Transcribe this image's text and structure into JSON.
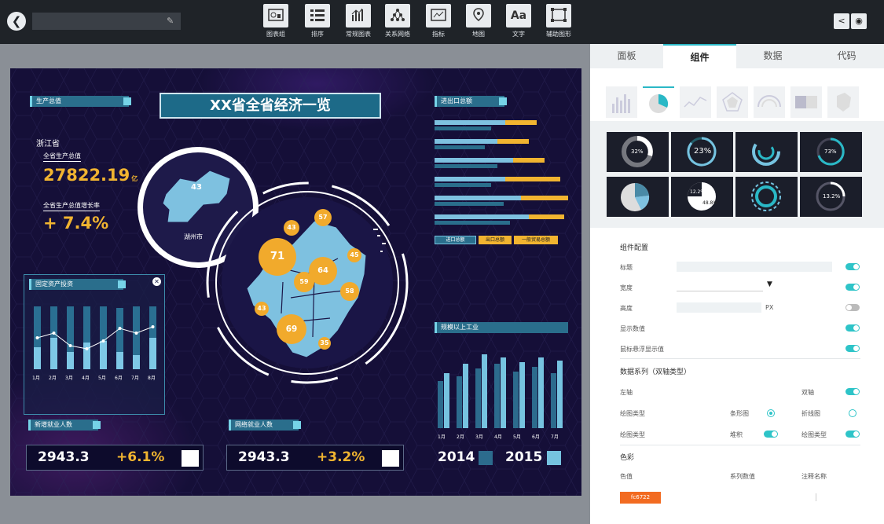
{
  "toolbar": {
    "title_value": "",
    "tools": [
      {
        "label": "图表组"
      },
      {
        "label": "排序"
      },
      {
        "label": "常规图表"
      },
      {
        "label": "关系网络"
      },
      {
        "label": "指标"
      },
      {
        "label": "地图"
      },
      {
        "label": "文字",
        "glyph": "Aa"
      },
      {
        "label": "辅助图形"
      }
    ]
  },
  "dashboard": {
    "title": "XX省全省经济一览",
    "gdp": {
      "section": "生产总值",
      "province": "浙江省",
      "total_label": "全省生产总值",
      "total_value": "27822.19",
      "total_unit": "亿",
      "growth_label": "全省生产总值增长率",
      "growth_value": "+ 7.4%"
    },
    "fixed_asset": {
      "title": "固定资产投资",
      "months": [
        "1月",
        "2月",
        "3月",
        "4月",
        "5月",
        "6月",
        "7月",
        "8月"
      ]
    },
    "city": {
      "value": "43",
      "name": "湖州市"
    },
    "import_export": {
      "title": "进出口总额",
      "legend": [
        "进口总额",
        "出口总额",
        "一般贸易总额"
      ]
    },
    "industry": {
      "title": "规模以上工业",
      "months": [
        "1月",
        "2月",
        "3月",
        "4月",
        "5月",
        "6月",
        "7月"
      ],
      "years": [
        "2014",
        "2015"
      ]
    },
    "employment": {
      "title": "新增就业人数",
      "value": "2943.3",
      "change": "+6.1%"
    },
    "network_employment": {
      "title": "网络就业人数",
      "value": "2943.3",
      "change": "+3.2%"
    },
    "map_bubbles": [
      {
        "value": "43"
      },
      {
        "value": "57"
      },
      {
        "value": "71"
      },
      {
        "value": "64"
      },
      {
        "value": "45"
      },
      {
        "value": "59"
      },
      {
        "value": "58"
      },
      {
        "value": "43"
      },
      {
        "value": "69"
      },
      {
        "value": "35"
      }
    ]
  },
  "panel": {
    "tabs": [
      "面板",
      "组件",
      "数据",
      "代码"
    ],
    "active_tab": "组件",
    "thumbs_text": [
      "32%",
      "23%",
      "73%",
      "12.2%",
      "48.8%",
      "13.2%"
    ],
    "config": {
      "heading": "组件配置",
      "title_label": "标题",
      "width_label": "宽度",
      "height_label": "高度",
      "height_unit": "PX",
      "show_values": "显示数值",
      "hover_values": "鼠标悬浮显示值",
      "series_heading": "数据系列（双轴类型）",
      "left_axis": "左轴",
      "dual_axis": "双轴",
      "draw_type": "绘图类型",
      "bar_label": "条形图",
      "line_label": "折线图",
      "draw_type2": "绘图类型",
      "stack_label": "堆积",
      "draw_type3": "绘图类型",
      "color_heading": "色彩",
      "color_value_label": "色值",
      "series_value_label": "系列数值",
      "note_label": "注释名称",
      "swatch": "#f26b21",
      "swatch_text": "fc6722"
    }
  },
  "colors": {
    "accent": "#2ab8c6",
    "orange": "#f1b430",
    "canvas_bg": "#150f38",
    "light_blue": "#76c3e0"
  }
}
